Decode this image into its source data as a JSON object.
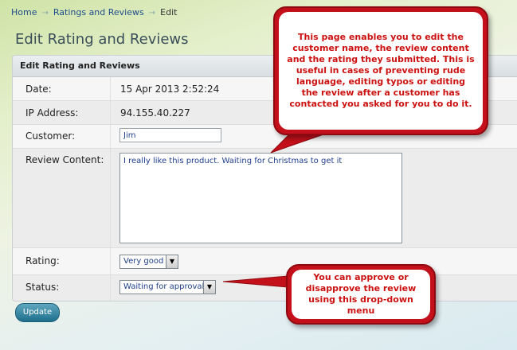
{
  "breadcrumb": {
    "home": "Home",
    "section": "Ratings and Reviews",
    "current": "Edit",
    "separator": "→"
  },
  "page_title": "Edit Rating and Reviews",
  "panel_title": "Edit Rating and Reviews",
  "fields": {
    "date": {
      "label": "Date:",
      "value": "15 Apr 2013 2:52:24"
    },
    "ip": {
      "label": "IP Address:",
      "value": "94.155.40.227"
    },
    "customer": {
      "label": "Customer:",
      "value": "Jim"
    },
    "review": {
      "label": "Review Content:",
      "value": "I really like this product. Waiting for Christmas to get it"
    },
    "rating": {
      "label": "Rating:",
      "value": "Very good"
    },
    "status": {
      "label": "Status:",
      "value": "Waiting for approval"
    }
  },
  "update_label": "Update",
  "callouts": {
    "top": "This page enables you to edit the customer name, the review content and the rating they submitted. This is useful in cases of preventing rude language, editing typos or editing the review after a customer has contacted you asked for you to do it.",
    "bottom": "You can approve or disapprove the review using this drop-down menu"
  },
  "colors": {
    "callout_border": "#c4101a",
    "callout_text": "#cc1111",
    "button": "#1e6f8d"
  }
}
